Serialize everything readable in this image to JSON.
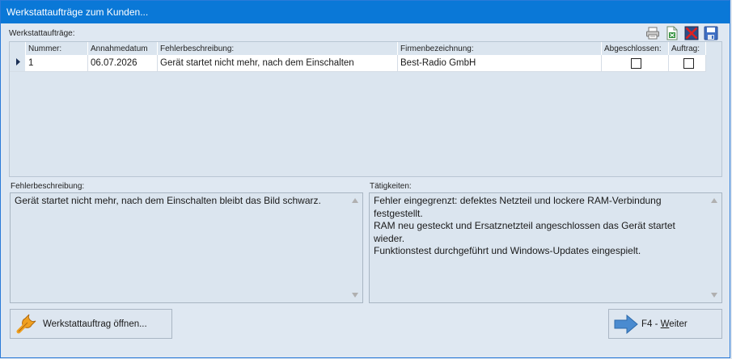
{
  "window": {
    "title": "Werkstattaufträge zum Kunden..."
  },
  "grid": {
    "label": "Werkstattaufträge:",
    "columns": [
      "Nummer:",
      "Annahmedatum",
      "Fehlerbeschreibung:",
      "Firmenbezeichnung:",
      "Abgeschlossen:",
      "Auftrag:"
    ],
    "rows": [
      {
        "nummer": "1",
        "datum": "06.07.2026",
        "fehler": "Gerät startet nicht mehr, nach dem Einschalten",
        "firma": "Best-Radio GmbH",
        "abgeschlossen": false,
        "auftrag": false
      }
    ]
  },
  "toolbar": {
    "icons": [
      "printer-icon",
      "excel-export-icon",
      "delete-icon",
      "save-icon"
    ]
  },
  "fehler": {
    "label": "Fehlerbeschreibung:",
    "text": "Gerät startet nicht mehr, nach dem Einschalten bleibt das Bild schwarz."
  },
  "taetigkeiten": {
    "label": "Tätigkeiten:",
    "lines": [
      "Fehler eingegrenzt: defektes Netzteil und lockere RAM-Verbindung",
      "festgestellt.",
      "RAM neu gesteckt und Ersatznetzteil angeschlossen  das Gerät startet",
      "wieder.",
      "Funktionstest durchgeführt und Windows-Updates eingespielt."
    ]
  },
  "buttons": {
    "open_label": "Werkstattauftrag öffnen...",
    "next_key": "F4 - ",
    "next_underlined": "W",
    "next_rest": "eiter"
  }
}
